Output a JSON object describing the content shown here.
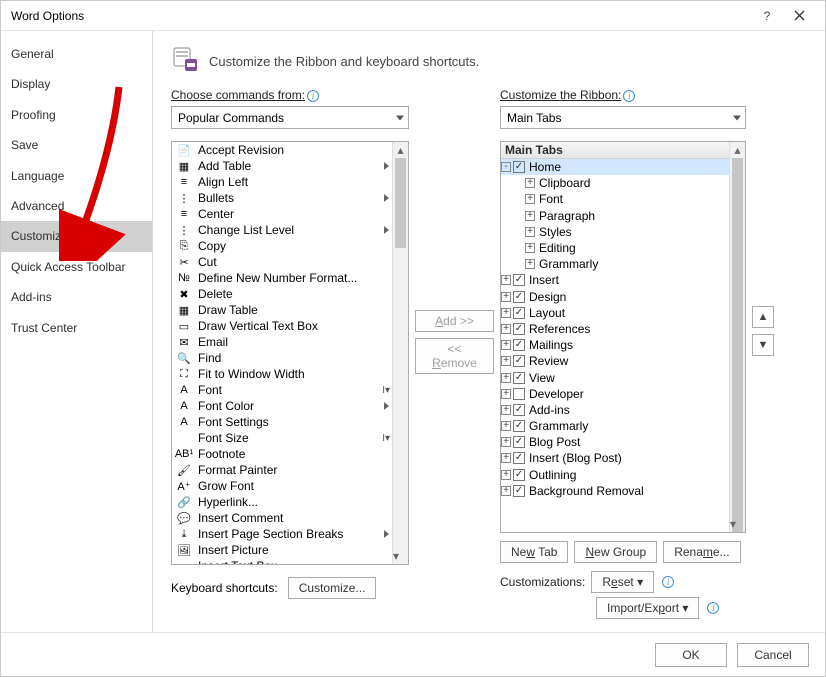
{
  "window": {
    "title": "Word Options"
  },
  "sidebar": {
    "items": [
      {
        "label": "General"
      },
      {
        "label": "Display"
      },
      {
        "label": "Proofing"
      },
      {
        "label": "Save"
      },
      {
        "label": "Language"
      },
      {
        "label": "Advanced"
      },
      {
        "label": "Customize Ribbon",
        "selected": true
      },
      {
        "label": "Quick Access Toolbar"
      },
      {
        "label": "Add-ins"
      },
      {
        "label": "Trust Center"
      }
    ]
  },
  "heading": "Customize the Ribbon and keyboard shortcuts.",
  "left": {
    "label": "Choose commands from:",
    "combo": "Popular Commands",
    "commands": [
      {
        "icon": "accept",
        "label": "Accept Revision"
      },
      {
        "icon": "table",
        "label": "Add Table",
        "submenu": true
      },
      {
        "icon": "alignl",
        "label": "Align Left"
      },
      {
        "icon": "bullets",
        "label": "Bullets",
        "submenu": true,
        "split": true
      },
      {
        "icon": "center",
        "label": "Center"
      },
      {
        "icon": "listlvl",
        "label": "Change List Level",
        "submenu": true
      },
      {
        "icon": "copy",
        "label": "Copy"
      },
      {
        "icon": "cut",
        "label": "Cut"
      },
      {
        "icon": "numfmt",
        "label": "Define New Number Format..."
      },
      {
        "icon": "delete",
        "label": "Delete"
      },
      {
        "icon": "drawtbl",
        "label": "Draw Table"
      },
      {
        "icon": "vtextbx",
        "label": "Draw Vertical Text Box"
      },
      {
        "icon": "email",
        "label": "Email"
      },
      {
        "icon": "find",
        "label": "Find"
      },
      {
        "icon": "fitwin",
        "label": "Fit to Window Width"
      },
      {
        "icon": "font",
        "label": "Font",
        "dd": true
      },
      {
        "icon": "fcolor",
        "label": "Font Color",
        "submenu": true
      },
      {
        "icon": "fset",
        "label": "Font Settings"
      },
      {
        "icon": "fsize",
        "label": "Font Size",
        "dd": true
      },
      {
        "icon": "footn",
        "label": "Footnote"
      },
      {
        "icon": "fpaint",
        "label": "Format Painter"
      },
      {
        "icon": "gfont",
        "label": "Grow Font"
      },
      {
        "icon": "link",
        "label": "Hyperlink..."
      },
      {
        "icon": "comment",
        "label": "Insert Comment"
      },
      {
        "icon": "pagebrk",
        "label": "Insert Page  Section Breaks",
        "submenu": true
      },
      {
        "icon": "pic",
        "label": "Insert Picture"
      },
      {
        "icon": "textbx",
        "label": "Insert Text Box"
      }
    ],
    "kb_label": "Keyboard shortcuts:",
    "kb_button": "Customize..."
  },
  "mid": {
    "add": "Add >>",
    "remove": "<< Remove"
  },
  "right": {
    "label": "Customize the Ribbon:",
    "combo": "Main Tabs",
    "tree_header": "Main Tabs",
    "home": {
      "label": "Home",
      "groups": [
        "Clipboard",
        "Font",
        "Paragraph",
        "Styles",
        "Editing",
        "Grammarly"
      ]
    },
    "tabs": [
      {
        "label": "Insert",
        "checked": true
      },
      {
        "label": "Design",
        "checked": true
      },
      {
        "label": "Layout",
        "checked": true
      },
      {
        "label": "References",
        "checked": true
      },
      {
        "label": "Mailings",
        "checked": true
      },
      {
        "label": "Review",
        "checked": true
      },
      {
        "label": "View",
        "checked": true
      },
      {
        "label": "Developer",
        "checked": false
      },
      {
        "label": "Add-ins",
        "checked": true
      },
      {
        "label": "Grammarly",
        "checked": true
      },
      {
        "label": "Blog Post",
        "checked": true
      },
      {
        "label": "Insert (Blog Post)",
        "checked": true
      },
      {
        "label": "Outlining",
        "checked": true
      },
      {
        "label": "Background Removal",
        "checked": true
      }
    ],
    "new_tab": "New Tab",
    "new_group": "New Group",
    "rename": "Rename...",
    "custom_label": "Customizations:",
    "reset": "Reset",
    "import_export": "Import/Export"
  },
  "footer": {
    "ok": "OK",
    "cancel": "Cancel"
  }
}
